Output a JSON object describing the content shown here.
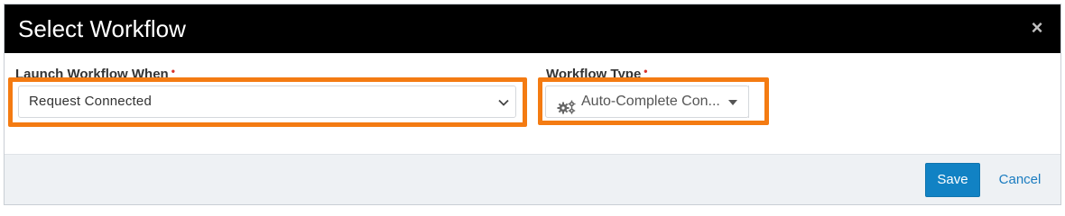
{
  "dialog": {
    "title": "Select Workflow",
    "close_label": "×"
  },
  "launch_field": {
    "label": "Launch Workflow When",
    "required_marker": "•",
    "selected_value": "Request Connected"
  },
  "type_field": {
    "label": "Workflow Type",
    "required_marker": "•",
    "selected_value": "Auto-Complete Con..."
  },
  "footer": {
    "save_label": "Save",
    "cancel_label": "Cancel"
  },
  "icons": {
    "gear": "gears-icon",
    "caret": "caret-down-icon",
    "chevron": "chevron-down-icon",
    "close": "close-icon"
  },
  "colors": {
    "header_bg": "#000000",
    "highlight": "#f47b12",
    "primary": "#1182c4",
    "required": "#d9342b"
  }
}
